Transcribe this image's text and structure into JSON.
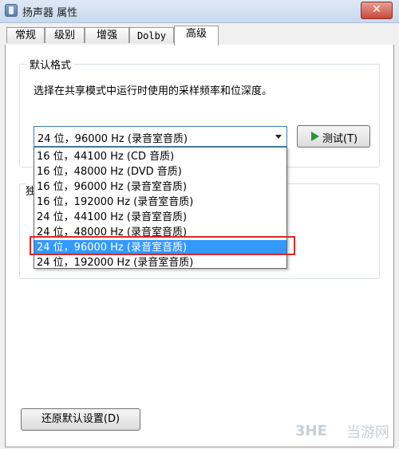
{
  "window": {
    "title": "扬声器 属性",
    "close_glyph": "✕"
  },
  "tabs": [
    {
      "label": "常规"
    },
    {
      "label": "级别"
    },
    {
      "label": "增强"
    },
    {
      "label": "Dolby"
    },
    {
      "label": "高级"
    }
  ],
  "default_format": {
    "group_label": "默认格式",
    "description": "选择在共享模式中运行时使用的采样频率和位深度。",
    "selected_value": "24 位，96000 Hz (录音室音质)",
    "test_button": "测试(T)",
    "options": [
      "16 位，44100 Hz (CD 音质)",
      "16 位，48000 Hz (DVD 音质)",
      "16 位，96000 Hz (录音室音质)",
      "16 位，192000 Hz (录音室音质)",
      "24 位，44100 Hz (录音室音质)",
      "24 位，48000 Hz (录音室音质)",
      "24 位，96000 Hz (录音室音质)",
      "24 位，192000 Hz (录音室音质)"
    ],
    "selected_index": 6
  },
  "exclusive_group_partial_label": "独",
  "restore_button": "还原默认设置(D)",
  "watermark": {
    "text": "当游网",
    "logo": "3HE"
  },
  "colors": {
    "selection": "#3399ff",
    "highlight_border": "#d8282c",
    "play_icon": "#1f9a2c"
  }
}
